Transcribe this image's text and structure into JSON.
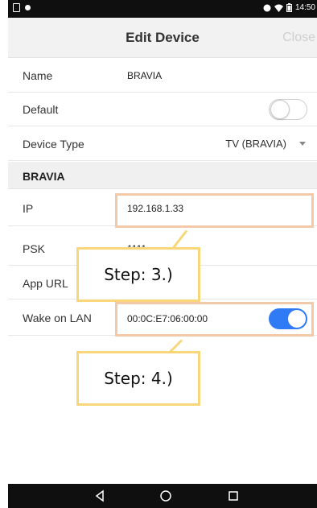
{
  "status_bar": {
    "time": "14:50",
    "left_icons": [
      "screenshot-icon",
      "notification-dot-icon"
    ],
    "right_icons": [
      "data-sync-icon",
      "wifi-icon",
      "battery-icon"
    ]
  },
  "header": {
    "title": "Edit Device",
    "close_label": "Close"
  },
  "form": {
    "name": {
      "label": "Name",
      "value": "BRAVIA"
    },
    "default": {
      "label": "Default",
      "state": "off"
    },
    "device_type": {
      "label": "Device Type",
      "value": "TV (BRAVIA)"
    }
  },
  "section": {
    "title": "BRAVIA",
    "ip": {
      "label": "IP",
      "value": "192.168.1.33"
    },
    "psk": {
      "label": "PSK",
      "value": "1111"
    },
    "app_url": {
      "label": "App URL",
      "value": ""
    },
    "wake_on_lan": {
      "label": "Wake on LAN",
      "value": "00:0C:E7:06:00:00",
      "state": "on"
    }
  },
  "annotations": {
    "step3": "Step: 3.)",
    "step4": "Step: 4.)",
    "highlight_color": "#f4c9a8",
    "callout_color": "#f7d77a"
  },
  "colors": {
    "accent": "#2f7af5",
    "close_disabled": "#cfcfcf"
  },
  "nav_bar": {
    "buttons": [
      "back-icon",
      "home-icon",
      "recents-icon"
    ]
  }
}
